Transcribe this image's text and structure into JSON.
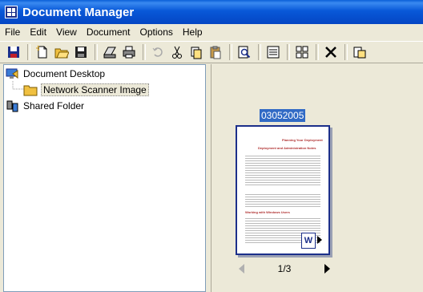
{
  "window": {
    "title": "Document Manager"
  },
  "menu": {
    "items": [
      "File",
      "Edit",
      "View",
      "Document",
      "Options",
      "Help"
    ]
  },
  "toolbar": {
    "buttons": [
      "save-disk",
      "new-document",
      "open-folder",
      "save",
      "scan",
      "print",
      "undo",
      "cut",
      "copy",
      "paste",
      "find",
      "properties",
      "thumbnails",
      "delete",
      "send-to"
    ]
  },
  "tree": {
    "items": [
      {
        "label": "Document Desktop",
        "icon": "desktop-icon"
      },
      {
        "label": "Network Scanner Image",
        "icon": "folder-icon"
      },
      {
        "label": "Shared Folder",
        "icon": "shared-folder-icon"
      }
    ]
  },
  "thumbnail": {
    "caption": "03052005",
    "doc_title": "Planning Your Deployment",
    "doc_subtitle": "Deployment and Administration Notes",
    "section_heading": "Working with Windows Users",
    "page_indicator": "1/3",
    "badge": "W"
  }
}
